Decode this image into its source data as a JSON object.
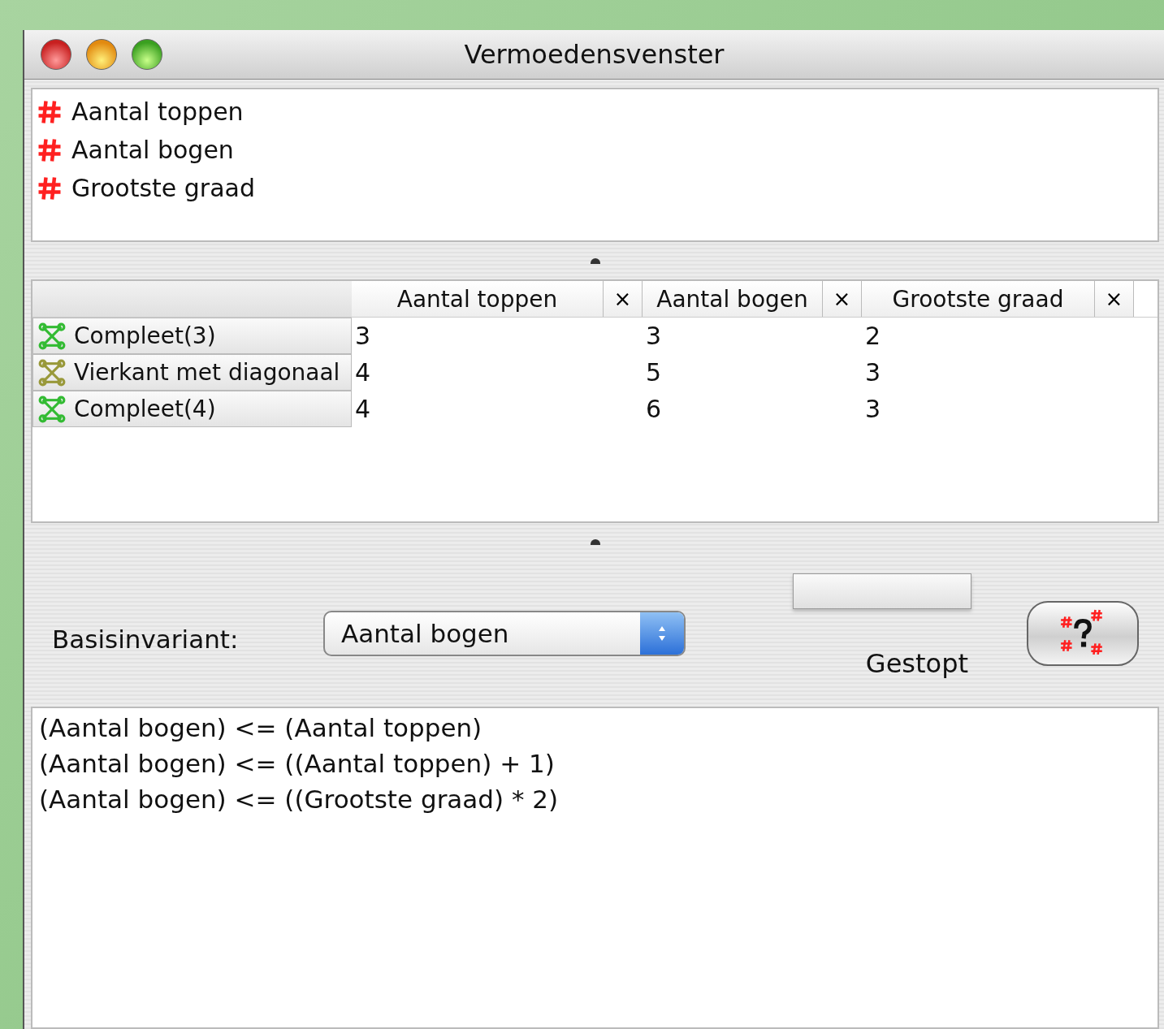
{
  "window": {
    "title": "Vermoedensvenster"
  },
  "invariants": [
    {
      "label": "Aantal toppen"
    },
    {
      "label": "Aantal bogen"
    },
    {
      "label": "Grootste graad"
    }
  ],
  "table": {
    "columns": [
      {
        "label": "Aantal toppen",
        "close": "×"
      },
      {
        "label": "Aantal bogen",
        "close": "×"
      },
      {
        "label": "Grootste graad",
        "close": "×"
      }
    ],
    "rows": [
      {
        "name": "Compleet(3)",
        "color": "#33bb33",
        "cells": [
          "3",
          "3",
          "2"
        ]
      },
      {
        "name": "Vierkant met diagonaal",
        "color": "#99993a",
        "cells": [
          "4",
          "5",
          "3"
        ]
      },
      {
        "name": "Compleet(4)",
        "color": "#33bb33",
        "cells": [
          "4",
          "6",
          "3"
        ]
      }
    ]
  },
  "base_invariant": {
    "label": "Basisinvariant:",
    "value": "Aantal bogen"
  },
  "progress": {
    "level": 0
  },
  "status": "Gestopt",
  "conjectures": [
    "(Aantal bogen) <= (Aantal toppen)",
    "(Aantal bogen) <= ((Aantal toppen) + 1)",
    "(Aantal bogen) <= ((Grootste graad) * 2)"
  ]
}
